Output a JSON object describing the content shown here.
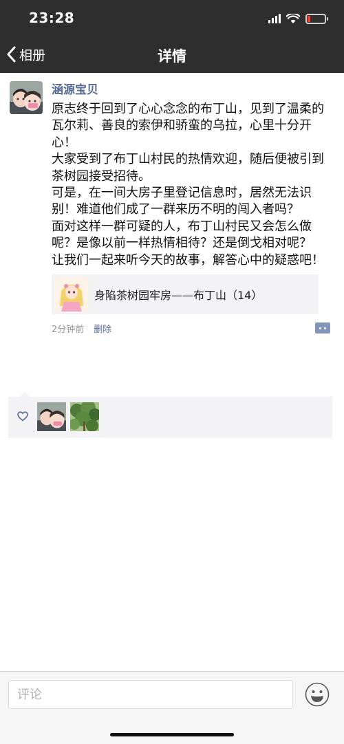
{
  "status_bar": {
    "time": "23:28",
    "battery_level": 0.15,
    "battery_color": "#ff3b30"
  },
  "nav": {
    "back_label": "相册",
    "title": "详情"
  },
  "post": {
    "author": "涵源宝贝",
    "text": "原志终于回到了心心念念的布丁山，见到了温柔的瓦尔莉、善良的索伊和骄蛮的乌拉，心里十分开心！\n大家受到了布丁山村民的热情欢迎，随后便被引到茶树园接受招待。\n可是，在一间大房子里登记信息时，居然无法识别！难道他们成了一群来历不明的闯入者吗？\n面对这样一群可疑的人，布丁山村民又会怎么做呢？是像以前一样热情相待？还是倒戈相对呢？\n让我们一起来听今天的故事，解答心中的疑惑吧！",
    "share_card_title": "身陷茶树园牢房——布丁山（14）",
    "time_ago": "2分钟前",
    "delete_label": "删除",
    "link_color": "#576b95"
  },
  "likes": {
    "icon": "heart-icon",
    "users": [
      "user-avatar-kids",
      "user-avatar-tree"
    ]
  },
  "comment": {
    "placeholder": "评论",
    "emoji_icon": "emoji-icon"
  }
}
